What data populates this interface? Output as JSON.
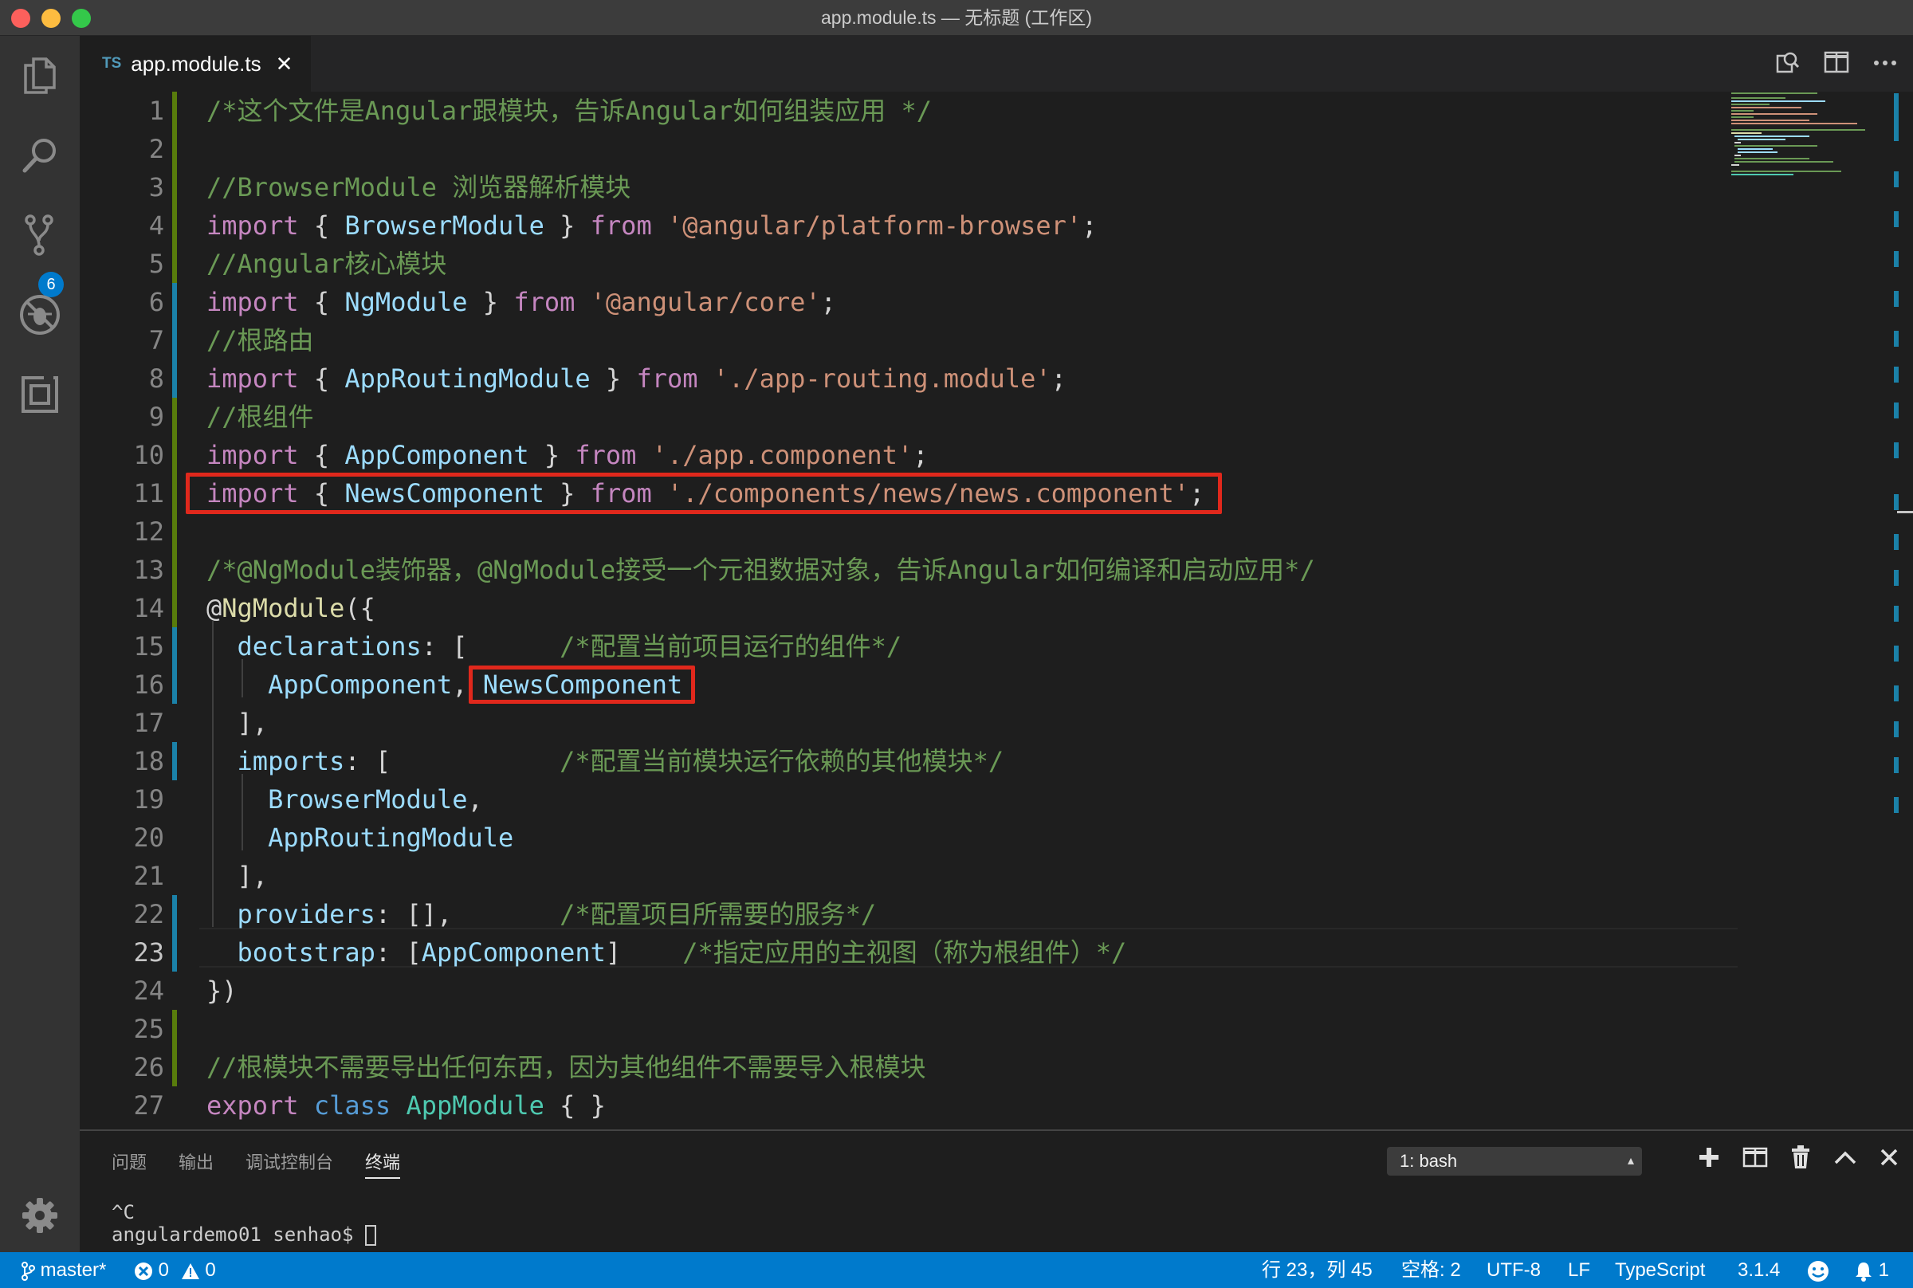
{
  "window": {
    "title": "app.module.ts — 无标题 (工作区)"
  },
  "activity_bar": {
    "source_control_badge": "6"
  },
  "tab": {
    "lang": "TS",
    "filename": "app.module.ts",
    "close": "✕"
  },
  "colors": {
    "keyword": "#c586c0",
    "variable": "#9cdcfe",
    "string": "#ce9178",
    "comment": "#6a9955",
    "punctuation": "#d4d4d4",
    "storage": "#569cd6",
    "class": "#4ec9b0",
    "function": "#dcdcaa",
    "gutter_modified": "#1b81a8",
    "gutter_added": "#587c0c",
    "highlight_box": "#e0281c",
    "status_bar": "#007acc"
  },
  "code_lines": [
    {
      "n": "1",
      "tokens": [
        [
          "/*这个文件是Angular跟模块，告诉Angular如何组装应用 */",
          "comment"
        ]
      ]
    },
    {
      "n": "2",
      "tokens": []
    },
    {
      "n": "3",
      "tokens": [
        [
          "//BrowserModule 浏览器解析模块",
          "comment"
        ]
      ]
    },
    {
      "n": "4",
      "tokens": [
        [
          "import",
          "keyword"
        ],
        [
          " { ",
          "punctuation"
        ],
        [
          "BrowserModule",
          "variable"
        ],
        [
          " } ",
          "punctuation"
        ],
        [
          "from",
          "keyword"
        ],
        [
          " ",
          "punctuation"
        ],
        [
          "'@angular/platform-browser'",
          "string"
        ],
        [
          ";",
          "punctuation"
        ]
      ]
    },
    {
      "n": "5",
      "tokens": [
        [
          "//Angular核心模块",
          "comment"
        ]
      ]
    },
    {
      "n": "6",
      "tokens": [
        [
          "import",
          "keyword"
        ],
        [
          " { ",
          "punctuation"
        ],
        [
          "NgModule",
          "variable"
        ],
        [
          " } ",
          "punctuation"
        ],
        [
          "from",
          "keyword"
        ],
        [
          " ",
          "punctuation"
        ],
        [
          "'@angular/core'",
          "string"
        ],
        [
          ";",
          "punctuation"
        ]
      ]
    },
    {
      "n": "7",
      "tokens": [
        [
          "//根路由",
          "comment"
        ]
      ]
    },
    {
      "n": "8",
      "tokens": [
        [
          "import",
          "keyword"
        ],
        [
          " { ",
          "punctuation"
        ],
        [
          "AppRoutingModule",
          "variable"
        ],
        [
          " } ",
          "punctuation"
        ],
        [
          "from",
          "keyword"
        ],
        [
          " ",
          "punctuation"
        ],
        [
          "'./app-routing.module'",
          "string"
        ],
        [
          ";",
          "punctuation"
        ]
      ]
    },
    {
      "n": "9",
      "tokens": [
        [
          "//根组件",
          "comment"
        ]
      ]
    },
    {
      "n": "10",
      "tokens": [
        [
          "import",
          "keyword"
        ],
        [
          " { ",
          "punctuation"
        ],
        [
          "AppComponent",
          "variable"
        ],
        [
          " } ",
          "punctuation"
        ],
        [
          "from",
          "keyword"
        ],
        [
          " ",
          "punctuation"
        ],
        [
          "'./app.component'",
          "string"
        ],
        [
          ";",
          "punctuation"
        ]
      ]
    },
    {
      "n": "11",
      "tokens": [
        [
          "import",
          "keyword"
        ],
        [
          " { ",
          "punctuation"
        ],
        [
          "NewsComponent",
          "variable"
        ],
        [
          " } ",
          "punctuation"
        ],
        [
          "from",
          "keyword"
        ],
        [
          " ",
          "punctuation"
        ],
        [
          "'./components/news/news.component'",
          "string"
        ],
        [
          ";",
          "punctuation"
        ]
      ]
    },
    {
      "n": "12",
      "tokens": []
    },
    {
      "n": "13",
      "tokens": [
        [
          "/*@NgModule装饰器，@NgModule接受一个元祖数据对象，告诉Angular如何编译和启动应用*/",
          "comment"
        ]
      ]
    },
    {
      "n": "14",
      "tokens": [
        [
          "@",
          "punctuation"
        ],
        [
          "NgModule",
          "function"
        ],
        [
          "({",
          "punctuation"
        ]
      ]
    },
    {
      "n": "15",
      "tokens": [
        [
          "  ",
          "punctuation"
        ],
        [
          "declarations",
          "variable"
        ],
        [
          ": [      ",
          "punctuation"
        ],
        [
          "/*配置当前项目运行的组件*/",
          "comment"
        ]
      ]
    },
    {
      "n": "16",
      "tokens": [
        [
          "    ",
          "punctuation"
        ],
        [
          "AppComponent",
          "variable"
        ],
        [
          ", ",
          "punctuation"
        ],
        [
          "NewsComponent",
          "variable"
        ]
      ]
    },
    {
      "n": "17",
      "tokens": [
        [
          "  ],",
          "punctuation"
        ]
      ]
    },
    {
      "n": "18",
      "tokens": [
        [
          "  ",
          "punctuation"
        ],
        [
          "imports",
          "variable"
        ],
        [
          ": [           ",
          "punctuation"
        ],
        [
          "/*配置当前模块运行依赖的其他模块*/",
          "comment"
        ]
      ]
    },
    {
      "n": "19",
      "tokens": [
        [
          "    ",
          "punctuation"
        ],
        [
          "BrowserModule",
          "variable"
        ],
        [
          ",",
          "punctuation"
        ]
      ]
    },
    {
      "n": "20",
      "tokens": [
        [
          "    ",
          "punctuation"
        ],
        [
          "AppRoutingModule",
          "variable"
        ]
      ]
    },
    {
      "n": "21",
      "tokens": [
        [
          "  ],",
          "punctuation"
        ]
      ]
    },
    {
      "n": "22",
      "tokens": [
        [
          "  ",
          "punctuation"
        ],
        [
          "providers",
          "variable"
        ],
        [
          ": [],       ",
          "punctuation"
        ],
        [
          "/*配置项目所需要的服务*/",
          "comment"
        ]
      ]
    },
    {
      "n": "23",
      "tokens": [
        [
          "  ",
          "punctuation"
        ],
        [
          "bootstrap",
          "variable"
        ],
        [
          ": [",
          "punctuation"
        ],
        [
          "AppComponent",
          "variable"
        ],
        [
          "]    ",
          "punctuation"
        ],
        [
          "/*指定应用的主视图（称为根组件）*/",
          "comment"
        ]
      ]
    },
    {
      "n": "24",
      "tokens": [
        [
          "})",
          "punctuation"
        ]
      ]
    },
    {
      "n": "25",
      "tokens": []
    },
    {
      "n": "26",
      "tokens": [
        [
          "//根模块不需要导出任何东西，因为其他组件不需要导入根模块",
          "comment"
        ]
      ]
    },
    {
      "n": "27",
      "tokens": [
        [
          "export",
          "keyword"
        ],
        [
          " ",
          "punctuation"
        ],
        [
          "class",
          "storage"
        ],
        [
          " ",
          "punctuation"
        ],
        [
          "AppModule",
          "class"
        ],
        [
          " { }",
          "punctuation"
        ]
      ]
    }
  ],
  "panel": {
    "tabs": [
      "问题",
      "输出",
      "调试控制台",
      "终端"
    ],
    "active_tab": "终端",
    "terminal_selector": "1: bash",
    "terminal_lines": [
      "^C",
      "angulardemo01 senhao$ "
    ]
  },
  "status_bar": {
    "branch": "master*",
    "errors": "0",
    "warnings": "0",
    "cursor_position": "行 23，列 45",
    "indent": "空格: 2",
    "encoding": "UTF-8",
    "eol": "LF",
    "language": "TypeScript",
    "ts_version": "3.1.4",
    "notifications": "1"
  }
}
